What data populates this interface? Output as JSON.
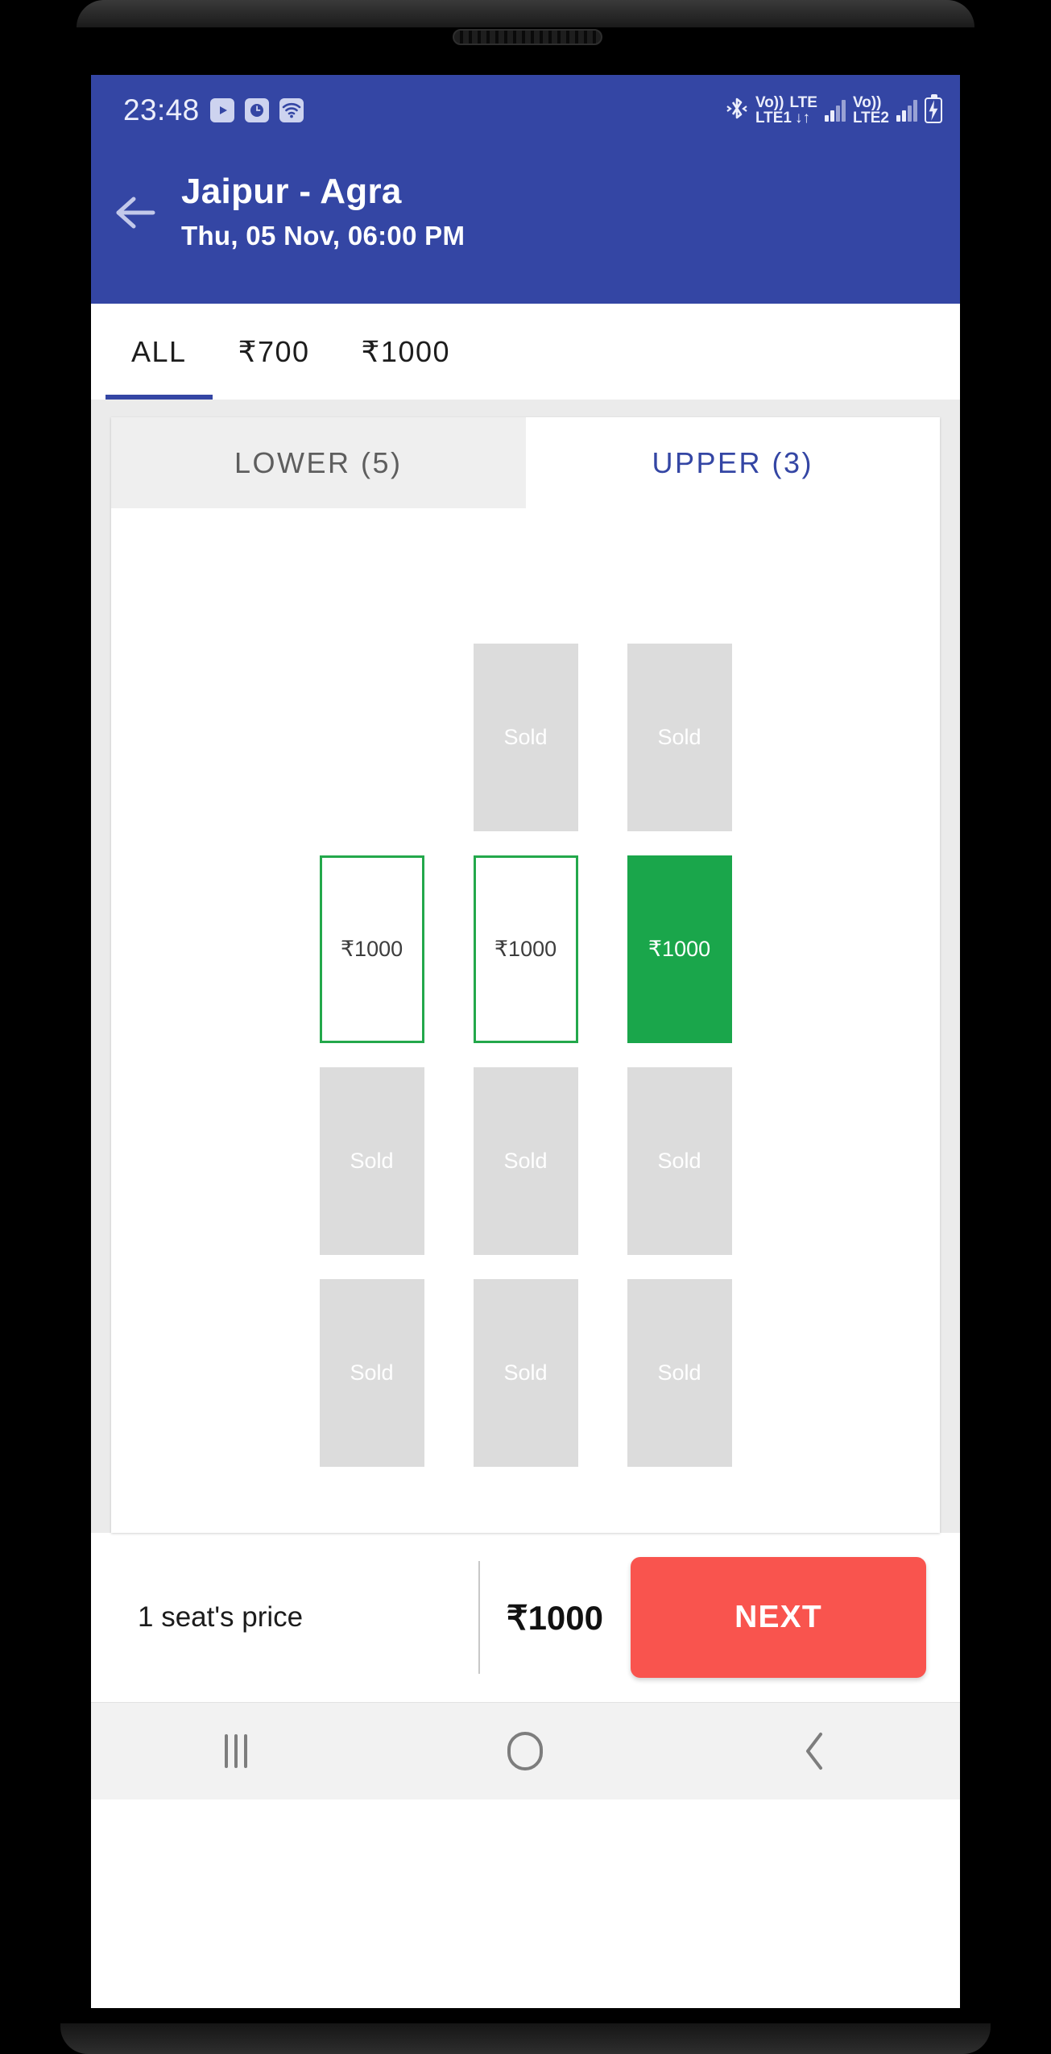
{
  "status_bar": {
    "time": "23:48",
    "left_icons": [
      "youtube-icon",
      "clock-icon",
      "wifi-icon"
    ],
    "bluetooth_icon": "bluetooth-icon",
    "sim1": {
      "volte": "Vo))",
      "network": "LTE",
      "label": "LTE1",
      "data_arrows": "↓↑"
    },
    "sim2": {
      "volte": "Vo))",
      "label": "LTE2"
    },
    "battery_icon": "battery-charging-icon"
  },
  "app_bar": {
    "back_icon": "back-arrow-icon",
    "route": "Jaipur - Agra",
    "datetime": "Thu, 05 Nov,  06:00 PM"
  },
  "price_tabs": {
    "items": [
      {
        "label": "ALL",
        "active": true
      },
      {
        "label": "₹700",
        "active": false
      },
      {
        "label": "₹1000",
        "active": false
      }
    ],
    "active_indicator_color": "#3446a4"
  },
  "deck_tabs": {
    "items": [
      {
        "label": "LOWER (5)",
        "active": false
      },
      {
        "label": "UPPER (3)",
        "active": true
      }
    ],
    "active_color": "#3446a4",
    "inactive_color": "#5e5e5e"
  },
  "seat_map": {
    "deck": "UPPER",
    "sold_label": "Sold",
    "price_label": "₹1000",
    "colors": {
      "sold": "#dcdcdc",
      "available_border": "#23a84b",
      "selected": "#1aa64b"
    },
    "rows": [
      [
        {
          "state": "blank",
          "label": ""
        },
        {
          "state": "sold",
          "label": "Sold"
        },
        {
          "state": "sold",
          "label": "Sold"
        }
      ],
      [
        {
          "state": "available",
          "label": "₹1000"
        },
        {
          "state": "available",
          "label": "₹1000"
        },
        {
          "state": "selected",
          "label": "₹1000"
        }
      ],
      [
        {
          "state": "sold",
          "label": "Sold"
        },
        {
          "state": "sold",
          "label": "Sold"
        },
        {
          "state": "sold",
          "label": "Sold"
        }
      ],
      [
        {
          "state": "sold",
          "label": "Sold"
        },
        {
          "state": "sold",
          "label": "Sold"
        },
        {
          "state": "sold",
          "label": "Sold"
        }
      ]
    ]
  },
  "bottom_bar": {
    "seat_price_label": "1 seat's price",
    "total_price": "₹1000",
    "next_label": "NEXT",
    "next_color": "#f9544e"
  },
  "nav_bar": {
    "recents_icon": "recents-icon",
    "home_icon": "home-icon",
    "back_icon": "back-icon"
  }
}
